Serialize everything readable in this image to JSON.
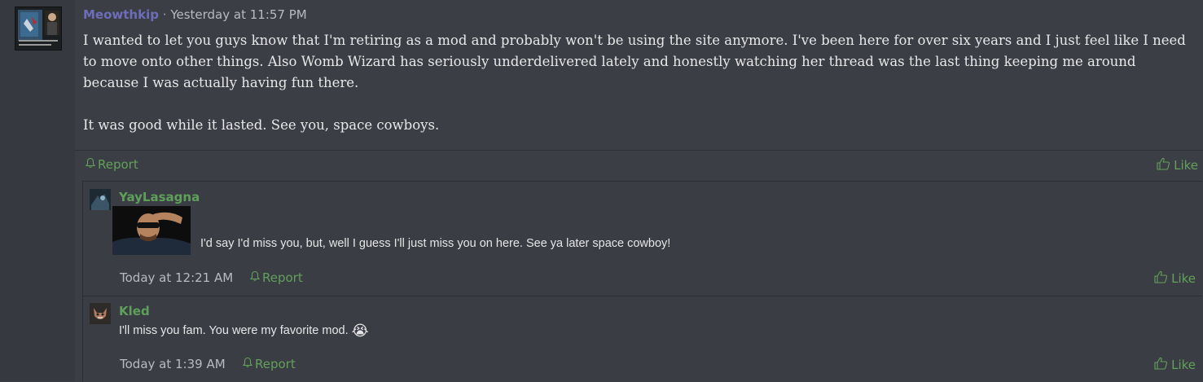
{
  "post": {
    "author": "Meowthkip",
    "separator": "·",
    "timestamp": "Yesterday at 11:57 PM",
    "paragraphs": [
      "I wanted to let you guys know that I'm retiring as a mod and probably won't be using the site anymore. I've been here for over six years and I just feel like I need to move onto other things. Also Womb Wizard has seriously underdelivered lately and honestly watching her thread was the last thing keeping me around because I was actually having fun there.",
      "It was good while it lasted. See you, space cowboys."
    ],
    "report_label": "Report",
    "like_label": "Like"
  },
  "comments": [
    {
      "author": "YayLasagna",
      "text": "I'd say I'd miss you, but, well I guess I'll just miss you on here. See ya later space cowboy!",
      "timestamp": "Today at 12:21 AM",
      "report_label": "Report",
      "like_label": "Like"
    },
    {
      "author": "Kled",
      "text": "I'll miss you fam. You were my favorite mod.",
      "emoji": "😭",
      "timestamp": "Today at 1:39 AM",
      "report_label": "Report",
      "like_label": "Like"
    }
  ],
  "colors": {
    "accent_green": "#63a05a",
    "author_purple": "#6d6db9",
    "background": "#3b3e45"
  },
  "icons": {
    "report": "bell-icon",
    "like": "thumbs-up-icon"
  }
}
